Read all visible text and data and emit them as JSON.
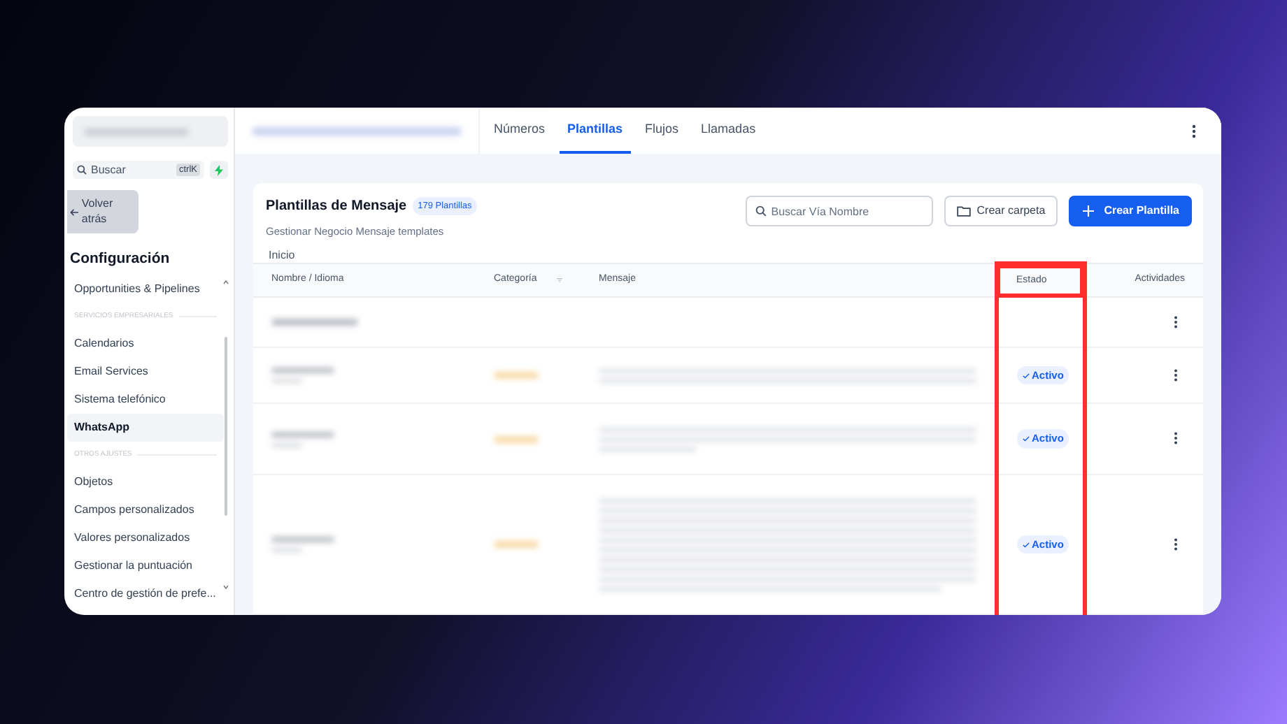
{
  "sidebar": {
    "search": {
      "placeholder": "Buscar",
      "shortcut": "ctrlK"
    },
    "back_button": "Volver atrás",
    "heading": "Configuración",
    "items": [
      {
        "kind": "link",
        "label": "Opportunities & Pipelines",
        "selected": false
      },
      {
        "kind": "section",
        "label": "SERVICIOS EMPRESARIALES"
      },
      {
        "kind": "link",
        "label": "Calendarios",
        "selected": false
      },
      {
        "kind": "link",
        "label": "Email Services",
        "selected": false
      },
      {
        "kind": "link",
        "label": "Sistema telefónico",
        "selected": false
      },
      {
        "kind": "link",
        "label": "WhatsApp",
        "selected": true
      },
      {
        "kind": "section",
        "label": "OTROS AJUSTES"
      },
      {
        "kind": "link",
        "label": "Objetos",
        "selected": false
      },
      {
        "kind": "link",
        "label": "Campos personalizados",
        "selected": false
      },
      {
        "kind": "link",
        "label": "Valores personalizados",
        "selected": false
      },
      {
        "kind": "link",
        "label": "Gestionar la puntuación",
        "selected": false
      },
      {
        "kind": "link",
        "label": "Centro de gestión de prefe...",
        "selected": false
      }
    ]
  },
  "tabs": [
    {
      "label": "Números",
      "selected": false
    },
    {
      "label": "Plantillas",
      "selected": true
    },
    {
      "label": "Flujos",
      "selected": false
    },
    {
      "label": "Llamadas",
      "selected": false
    }
  ],
  "card": {
    "title": "Plantillas de Mensaje",
    "count_badge": "179 Plantillas",
    "subtitle": "Gestionar Negocio Mensaje templates",
    "breadcrumb": "Inicio",
    "search": {
      "placeholder": "Buscar Vía Nombre"
    },
    "folder_button": "Crear carpeta",
    "create_button": "Crear Plantilla"
  },
  "table": {
    "columns": [
      {
        "label": "Nombre / Idioma",
        "filter": false,
        "highlighted": false
      },
      {
        "label": "Categoría",
        "filter": true,
        "highlighted": false
      },
      {
        "label": "Mensaje",
        "filter": false,
        "highlighted": false
      },
      {
        "label": "Estado",
        "filter": false,
        "highlighted": true
      },
      {
        "label": "Actividades",
        "filter": false,
        "highlighted": false
      }
    ],
    "rows": [
      {
        "kind": "folder"
      },
      {
        "kind": "template",
        "status": "Activo"
      },
      {
        "kind": "template",
        "status": "Activo"
      },
      {
        "kind": "template",
        "status": "Activo"
      }
    ]
  }
}
